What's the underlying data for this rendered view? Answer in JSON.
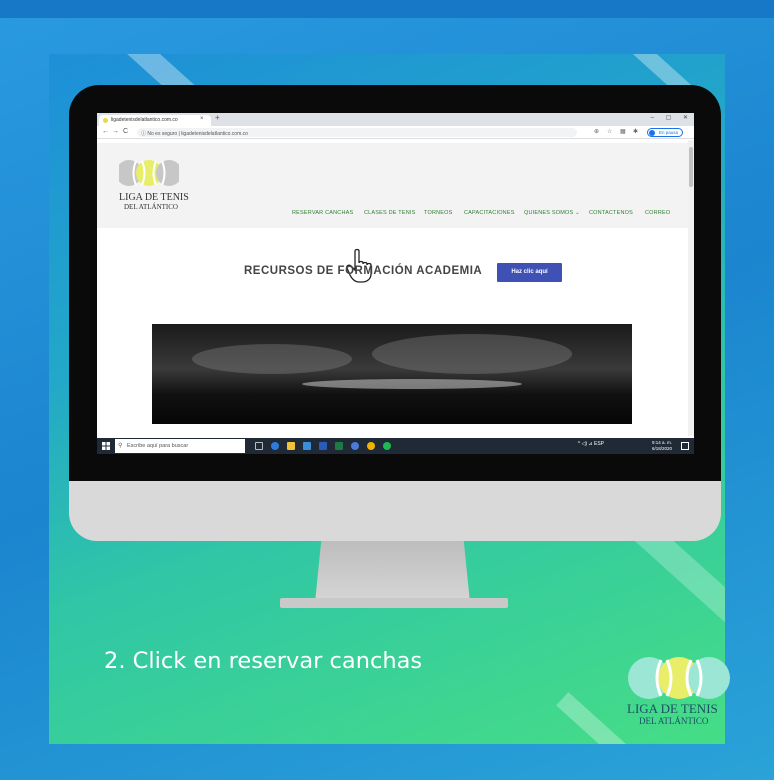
{
  "browser": {
    "tab_title": "ligadetenisdelatlantico.com.co",
    "tab_close": "×",
    "new_tab": "+",
    "window_controls": "– ▢ ✕",
    "nav_back": "←",
    "nav_forward": "→",
    "nav_reload": "C",
    "url_text": "ⓘ No es seguro | ligadetenisdelatlantico.com.co",
    "pause_label": "En pausa"
  },
  "site": {
    "logo_line1": "LIGA DE TENIS",
    "logo_line2": "DEL ATLÁNTICO",
    "menu": {
      "reservar": "RESERVAR CANCHAS",
      "clases": "CLASES DE TENIS",
      "torneos": "TORNEOS",
      "capacitaciones": "CAPACITACIONES",
      "quienes": "QUIENES SOMOS ⌄",
      "contactenos": "CONTACTENOS",
      "correo": "CORREO"
    },
    "heading": "RECURSOS DE FORMACIÓN ACADEMIA",
    "cta_label": "Haz clic aquí"
  },
  "taskbar": {
    "search_placeholder": "Escribe aquí para buscar",
    "tray_text": "^ ◁) ⊿ ESP",
    "time": "9:14 a. m.",
    "date": "6/18/2020"
  },
  "caption": "2. Click en reservar canchas",
  "corner_logo": {
    "line1": "LIGA DE TENIS",
    "line2": "DEL ATLÁNTICO"
  },
  "colors": {
    "menu_green": "#2f7d33",
    "cta_blue": "#3f51b5",
    "logo_yellow": "#e8ed6a",
    "logo_gray": "#c7c7c7"
  }
}
